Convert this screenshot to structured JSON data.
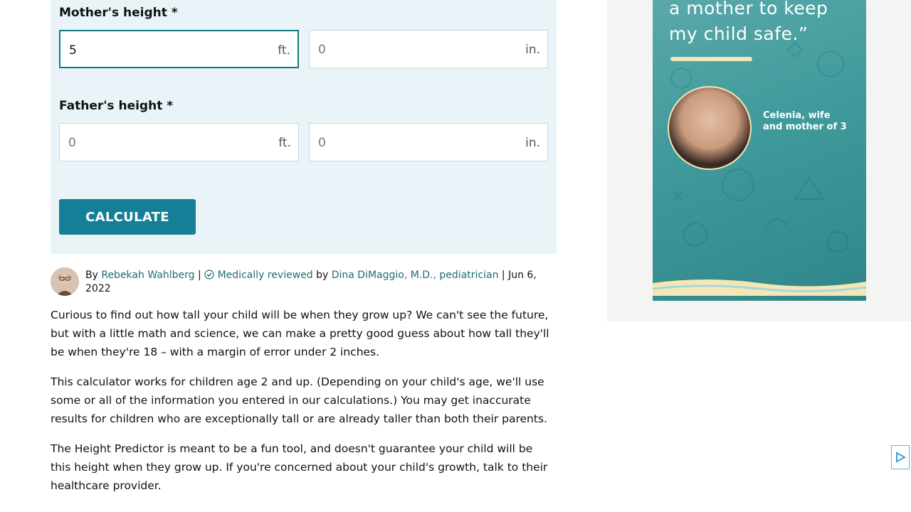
{
  "form": {
    "mother_label": "Mother's height *",
    "mother_ft_value": "5",
    "mother_ft_unit": "ft.",
    "mother_in_placeholder": "0",
    "mother_in_unit": "in.",
    "father_label": "Father's height *",
    "father_ft_placeholder": "0",
    "father_ft_unit": "ft.",
    "father_in_placeholder": "0",
    "father_in_unit": "in.",
    "calculate_label": "CALCULATE"
  },
  "byline": {
    "by": "By",
    "author": "Rebekah Wahlberg",
    "sep": "|",
    "reviewed": "Medically reviewed",
    "by2": "by",
    "reviewer": "Dina DiMaggio, M.D., pediatrician",
    "date": "| Jun 6, 2022"
  },
  "article": {
    "p1": "Curious to find out how tall your child will be when they grow up? We can't see the future, but with a little math and science, we can make a pretty good guess about how tall they'll be when they're 18 – with a margin of error under 2 inches.",
    "p2": "This calculator works for children age 2 and up. (Depending on your child's age, we'll use some or all of the information you entered in our calculations.) You may get inaccurate results for children who are exceptionally tall or are already taller than both their parents.",
    "p3": "The Height Predictor is meant to be a fun tool, and doesn't guarantee your child will be this height when they grow up. If you're concerned about your child's growth, talk to their healthcare provider."
  },
  "ad": {
    "quote_line1": "a mother to keep",
    "quote_line2": "my child safe.”",
    "caption_line1": "Celenia, wife",
    "caption_line2": "and mother of 3"
  },
  "colors": {
    "accent": "#147f96",
    "panel": "#eaf4f8",
    "ad_teal": "#3f9a9b"
  }
}
